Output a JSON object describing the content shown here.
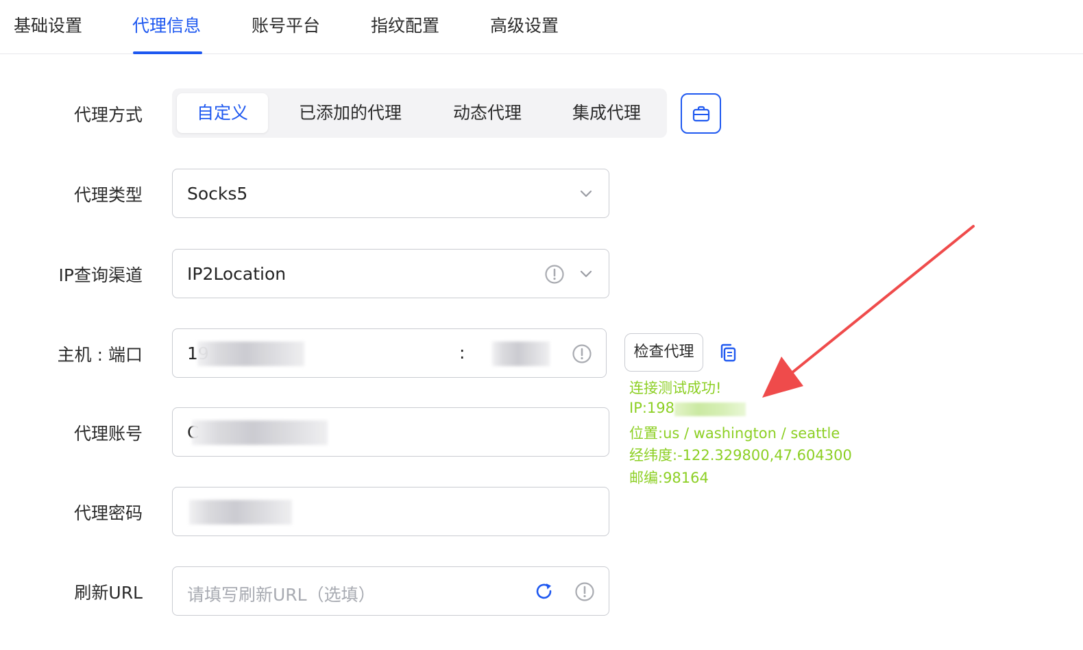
{
  "tabs": [
    {
      "label": "基础设置",
      "active": false
    },
    {
      "label": "代理信息",
      "active": true
    },
    {
      "label": "账号平台",
      "active": false
    },
    {
      "label": "指纹配置",
      "active": false
    },
    {
      "label": "高级设置",
      "active": false
    }
  ],
  "proxy_method": {
    "label": "代理方式",
    "options": [
      "自定义",
      "已添加的代理",
      "动态代理",
      "集成代理"
    ],
    "selected": "自定义",
    "icon": "bag-icon"
  },
  "proxy_type": {
    "label": "代理类型",
    "value": "Socks5"
  },
  "ip_channel": {
    "label": "IP查询渠道",
    "value": "IP2Location"
  },
  "host_port": {
    "label": "主机 : 端口",
    "host_visible": "19",
    "separator": ":"
  },
  "account": {
    "label": "代理账号",
    "visible": "C"
  },
  "password": {
    "label": "代理密码"
  },
  "refresh_url": {
    "label": "刷新URL",
    "placeholder": "请填写刷新URL（选填）"
  },
  "check_button": "检查代理",
  "result": {
    "status": "连接测试成功!",
    "ip": "IP:198.",
    "location": "位置:us / washington / seattle",
    "coords": "经纬度:-122.329800,47.604300",
    "zip": "邮编:98164"
  },
  "colors": {
    "accent": "#1e58f0",
    "success": "#8ccf23",
    "arrow": "#ef4b4b"
  }
}
